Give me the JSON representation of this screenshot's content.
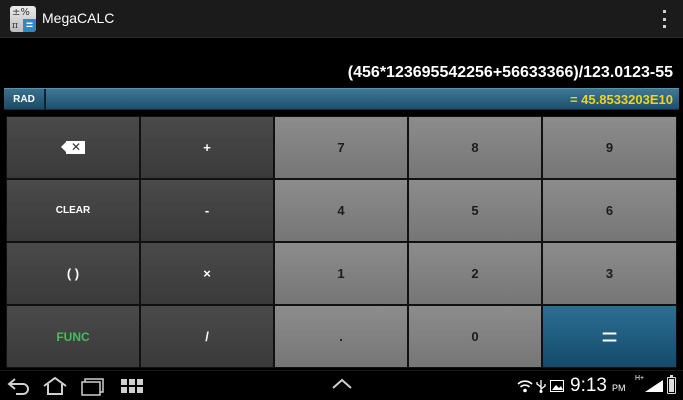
{
  "action_bar": {
    "title": "MegaCALC",
    "icon_glyph_top": "±%",
    "icon_glyph_pi": "π",
    "icon_glyph_equals": "=",
    "overflow_icon": "overflow-menu-icon"
  },
  "display": {
    "expression": "(456*123695542256+56633366)/123.0123-55",
    "result": "= 45.8533203E10",
    "angle_mode": "RAD"
  },
  "keypad": {
    "rows": [
      [
        {
          "name": "backspace-button",
          "label": "",
          "icon": "backspace-icon",
          "style": "dark"
        },
        {
          "name": "plus-button",
          "label": "+",
          "style": "dark"
        },
        {
          "name": "digit-7-button",
          "label": "7",
          "style": "light"
        },
        {
          "name": "digit-8-button",
          "label": "8",
          "style": "light"
        },
        {
          "name": "digit-9-button",
          "label": "9",
          "style": "light"
        }
      ],
      [
        {
          "name": "clear-button",
          "label": "CLEAR",
          "style": "dark"
        },
        {
          "name": "minus-button",
          "label": "-",
          "style": "dark"
        },
        {
          "name": "digit-4-button",
          "label": "4",
          "style": "light"
        },
        {
          "name": "digit-5-button",
          "label": "5",
          "style": "light"
        },
        {
          "name": "digit-6-button",
          "label": "6",
          "style": "light"
        }
      ],
      [
        {
          "name": "parentheses-button",
          "label": "( )",
          "style": "dark"
        },
        {
          "name": "multiply-button",
          "label": "×",
          "style": "dark"
        },
        {
          "name": "digit-1-button",
          "label": "1",
          "style": "light"
        },
        {
          "name": "digit-2-button",
          "label": "2",
          "style": "light"
        },
        {
          "name": "digit-3-button",
          "label": "3",
          "style": "light"
        }
      ],
      [
        {
          "name": "func-button",
          "label": "FUNC",
          "style": "dark"
        },
        {
          "name": "divide-button",
          "label": "/",
          "style": "dark"
        },
        {
          "name": "decimal-point-button",
          "label": ".",
          "style": "light"
        },
        {
          "name": "digit-0-button",
          "label": "0",
          "style": "light"
        },
        {
          "name": "equals-button",
          "label": "=",
          "style": "eq"
        }
      ]
    ]
  },
  "nav_bar": {
    "icons": [
      "back-icon",
      "home-icon",
      "recent-apps-icon",
      "app-grid-icon",
      "chevron-up-icon"
    ]
  },
  "status_bar": {
    "time": "9:13",
    "meridiem": "PM",
    "network_type": "H+",
    "icons": [
      "wifi-icon",
      "usb-icon",
      "gallery-icon",
      "signal-icon",
      "battery-icon"
    ]
  },
  "colors": {
    "result_text": "#f2d21a",
    "func_text": "#3ec15a",
    "accent_blue": "#1d4f6c"
  }
}
